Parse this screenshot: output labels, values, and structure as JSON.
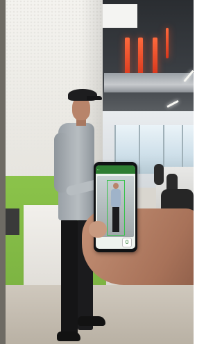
{
  "scene": {
    "description_free": true,
    "colors": {
      "green_wall": "#8bc34a",
      "ceiling_light": "#ff6a3d",
      "phone_app_bar": "#2e7d32",
      "detection_box": "#36c24a"
    }
  },
  "phone": {
    "app_bar_title": "",
    "status_value": "0",
    "icons": {
      "back": "back-arrow-icon"
    }
  }
}
